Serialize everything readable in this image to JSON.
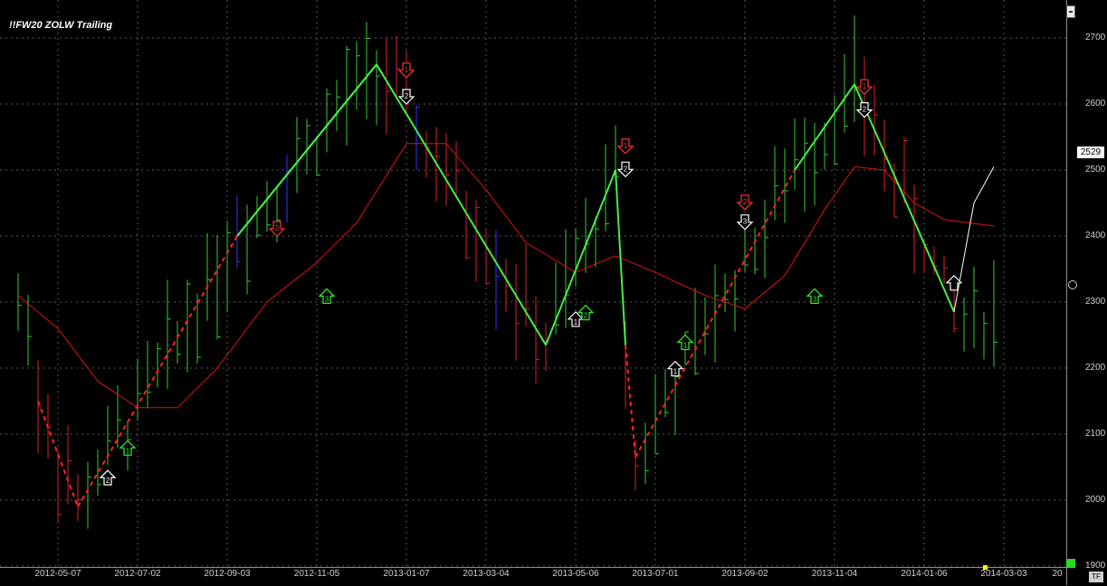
{
  "title": "!!FW20 ZOLW Trailing",
  "last_price_label": "2529",
  "tf_label": "TF",
  "y_ticks": [
    "2700",
    "2600",
    "2500",
    "2400",
    "2300",
    "2200",
    "2100",
    "2000",
    "1900"
  ],
  "x_ticks": [
    "2012-05-07",
    "2012-07-02",
    "2012-09-03",
    "2012-11-05",
    "2013-01-07",
    "2013-03-04",
    "2013-05-06",
    "2013-07-01",
    "2013-09-02",
    "2013-11-04",
    "2014-01-06",
    "2014-03-03",
    "20"
  ],
  "colors": {
    "background": "#000000",
    "grid": "#5a5a5a",
    "up_bar": "#33cc33",
    "down_bar": "#dd2222",
    "neutral_bar": "#3333ff",
    "zigzag": "#44ee44",
    "zigzag_dashed": "#ff2222",
    "moving_average": "#dd1111",
    "projection": "#ffffff"
  },
  "chart_data": {
    "type": "line",
    "title": "!!FW20 ZOLW Trailing",
    "ylim": [
      1890,
      2720
    ],
    "xlabel": "",
    "ylabel": "",
    "grid": true,
    "zigzag": [
      {
        "x": "2012-04-23",
        "y": 2150
      },
      {
        "x": "2012-05-21",
        "y": 1990
      },
      {
        "x": "2012-09-10",
        "y": 2400
      },
      {
        "x": "2012-12-17",
        "y": 2660
      },
      {
        "x": "2013-04-15",
        "y": 2235
      },
      {
        "x": "2013-06-03",
        "y": 2500
      },
      {
        "x": "2013-06-10",
        "y": 2235
      },
      {
        "x": "2013-06-17",
        "y": 2065
      },
      {
        "x": "2013-10-07",
        "y": 2500
      },
      {
        "x": "2013-11-18",
        "y": 2630
      },
      {
        "x": "2014-01-27",
        "y": 2285
      }
    ],
    "projection": [
      {
        "x": "2014-01-27",
        "y": 2285
      },
      {
        "x": "2014-02-10",
        "y": 2450
      },
      {
        "x": "2014-02-24",
        "y": 2505
      }
    ],
    "moving_average": [
      {
        "x": "2012-04-09",
        "y": 2310
      },
      {
        "x": "2012-05-07",
        "y": 2260
      },
      {
        "x": "2012-06-04",
        "y": 2180
      },
      {
        "x": "2012-07-02",
        "y": 2140
      },
      {
        "x": "2012-07-30",
        "y": 2140
      },
      {
        "x": "2012-08-27",
        "y": 2200
      },
      {
        "x": "2012-10-01",
        "y": 2300
      },
      {
        "x": "2012-11-05",
        "y": 2360
      },
      {
        "x": "2012-12-03",
        "y": 2420
      },
      {
        "x": "2013-01-07",
        "y": 2540
      },
      {
        "x": "2013-02-04",
        "y": 2540
      },
      {
        "x": "2013-03-04",
        "y": 2470
      },
      {
        "x": "2013-04-01",
        "y": 2390
      },
      {
        "x": "2013-05-06",
        "y": 2345
      },
      {
        "x": "2013-06-03",
        "y": 2370
      },
      {
        "x": "2013-07-01",
        "y": 2345
      },
      {
        "x": "2013-08-05",
        "y": 2310
      },
      {
        "x": "2013-09-02",
        "y": 2290
      },
      {
        "x": "2013-09-30",
        "y": 2340
      },
      {
        "x": "2013-10-28",
        "y": 2440
      },
      {
        "x": "2013-11-18",
        "y": 2505
      },
      {
        "x": "2013-12-09",
        "y": 2500
      },
      {
        "x": "2013-12-30",
        "y": 2450
      },
      {
        "x": "2014-01-20",
        "y": 2425
      },
      {
        "x": "2014-02-24",
        "y": 2415
      }
    ],
    "signals": [
      {
        "x": "2012-06-11",
        "y": 2045,
        "dir": "up",
        "label": "2",
        "color": "white"
      },
      {
        "x": "2012-06-25",
        "y": 2090,
        "dir": "up",
        "label": "1",
        "color": "green"
      },
      {
        "x": "2012-10-08",
        "y": 2400,
        "dir": "down",
        "label": "2",
        "color": "red"
      },
      {
        "x": "2012-11-12",
        "y": 2320,
        "dir": "up",
        "label": "3",
        "color": "green"
      },
      {
        "x": "2013-01-07",
        "y": 2640,
        "dir": "down",
        "label": "1",
        "color": "red"
      },
      {
        "x": "2013-01-07",
        "y": 2600,
        "dir": "down",
        "label": "2",
        "color": "white"
      },
      {
        "x": "2013-05-06",
        "y": 2285,
        "dir": "up",
        "label": "1",
        "color": "white"
      },
      {
        "x": "2013-05-13",
        "y": 2295,
        "dir": "up",
        "label": "2",
        "color": "green"
      },
      {
        "x": "2013-06-10",
        "y": 2525,
        "dir": "down",
        "label": "1",
        "color": "red"
      },
      {
        "x": "2013-06-10",
        "y": 2490,
        "dir": "down",
        "label": "2",
        "color": "white"
      },
      {
        "x": "2013-07-15",
        "y": 2210,
        "dir": "up",
        "label": "1",
        "color": "white"
      },
      {
        "x": "2013-07-22",
        "y": 2250,
        "dir": "up",
        "label": "1",
        "color": "green"
      },
      {
        "x": "2013-09-02",
        "y": 2440,
        "dir": "down",
        "label": "2",
        "color": "red"
      },
      {
        "x": "2013-09-02",
        "y": 2410,
        "dir": "down",
        "label": "3",
        "color": "white"
      },
      {
        "x": "2013-10-21",
        "y": 2320,
        "dir": "up",
        "label": "3",
        "color": "green"
      },
      {
        "x": "2013-11-25",
        "y": 2615,
        "dir": "down",
        "label": "1",
        "color": "red"
      },
      {
        "x": "2013-11-25",
        "y": 2580,
        "dir": "down",
        "label": "2",
        "color": "white"
      },
      {
        "x": "2014-01-27",
        "y": 2340,
        "dir": "up",
        "label": "",
        "color": "white"
      }
    ]
  }
}
